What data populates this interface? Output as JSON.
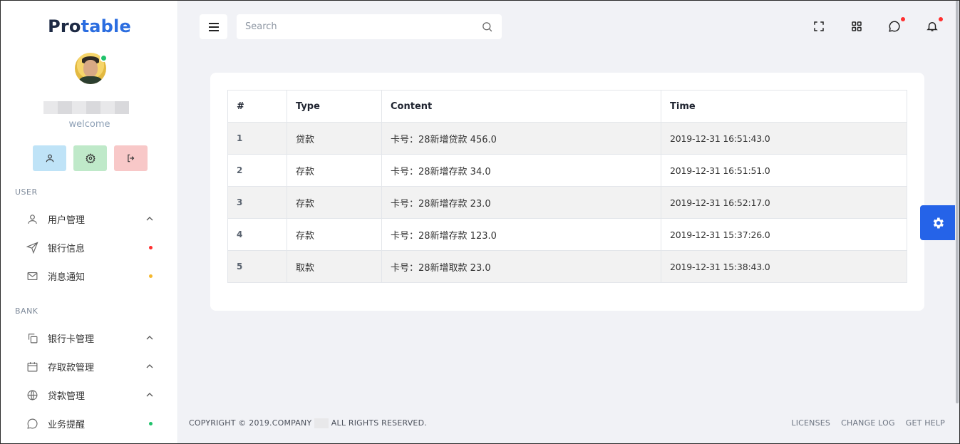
{
  "brand": {
    "pro": "Pro",
    "table": "table"
  },
  "user": {
    "welcome": "welcome"
  },
  "sidebar": {
    "sections": [
      {
        "title": "USER"
      },
      {
        "title": "BANK"
      }
    ],
    "items": [
      {
        "label": "用户管理",
        "icon": "user-icon",
        "trailing": "chevron-up"
      },
      {
        "label": "银行信息",
        "icon": "send-icon",
        "trailing": "dot",
        "dot_color": "#ff2f2f"
      },
      {
        "label": "消息通知",
        "icon": "mail-icon",
        "trailing": "dot",
        "dot_color": "#f5b82e"
      },
      {
        "label": "银行卡管理",
        "icon": "copy-icon",
        "trailing": "chevron-up"
      },
      {
        "label": "存取款管理",
        "icon": "calendar-icon",
        "trailing": "chevron-up"
      },
      {
        "label": "贷款管理",
        "icon": "globe-icon",
        "trailing": "chevron-up"
      },
      {
        "label": "业务提醒",
        "icon": "chat-icon",
        "trailing": "dot",
        "dot_color": "#1fc26b"
      }
    ]
  },
  "search": {
    "placeholder": "Search"
  },
  "table": {
    "headers": [
      "#",
      "Type",
      "Content",
      "Time"
    ],
    "rows": [
      {
        "num": "1",
        "type": "贷款",
        "content": "卡号：28新增贷款 456.0",
        "time": "2019-12-31 16:51:43.0"
      },
      {
        "num": "2",
        "type": "存款",
        "content": "卡号：28新增存款 34.0",
        "time": "2019-12-31 16:51:51.0"
      },
      {
        "num": "3",
        "type": "存款",
        "content": "卡号：28新增存款 23.0",
        "time": "2019-12-31 16:52:17.0"
      },
      {
        "num": "4",
        "type": "存款",
        "content": "卡号：28新增存款 123.0",
        "time": "2019-12-31 15:37:26.0"
      },
      {
        "num": "5",
        "type": "取款",
        "content": "卡号：28新增取款 23.0",
        "time": "2019-12-31 15:38:43.0"
      }
    ]
  },
  "footer": {
    "copyright_pre": "COPYRIGHT © 2019.COMPANY",
    "copyright_post": "ALL RIGHTS RESERVED.",
    "links": [
      "LICENSES",
      "CHANGE LOG",
      "GET HELP"
    ]
  },
  "colors": {
    "accent": "#2563e8",
    "brand_blue": "#2b6de0"
  }
}
